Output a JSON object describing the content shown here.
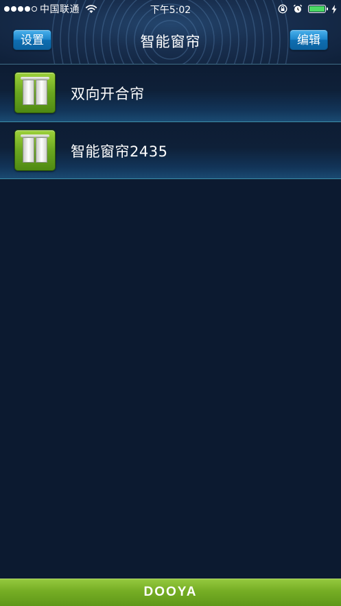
{
  "status_bar": {
    "carrier": "中国联通",
    "time": "下午5:02",
    "signal_bars_filled": 4,
    "signal_bars_total": 5,
    "battery_level": 1.0,
    "icons": [
      "wifi-icon",
      "orientation-lock-icon",
      "alarm-icon",
      "battery-icon",
      "charging-bolt-icon"
    ]
  },
  "nav": {
    "title": "智能窗帘",
    "left_button": "设置",
    "right_button": "编辑"
  },
  "devices": [
    {
      "name": "双向开合帘",
      "icon": "curtain-icon"
    },
    {
      "name": "智能窗帘2435",
      "icon": "curtain-icon"
    }
  ],
  "footer": {
    "logo": "DOOYA"
  },
  "colors": {
    "background": "#0c1a30",
    "accent_blue": "#1d86cb",
    "accent_green": "#75ad24",
    "battery_green": "#4cd964"
  }
}
